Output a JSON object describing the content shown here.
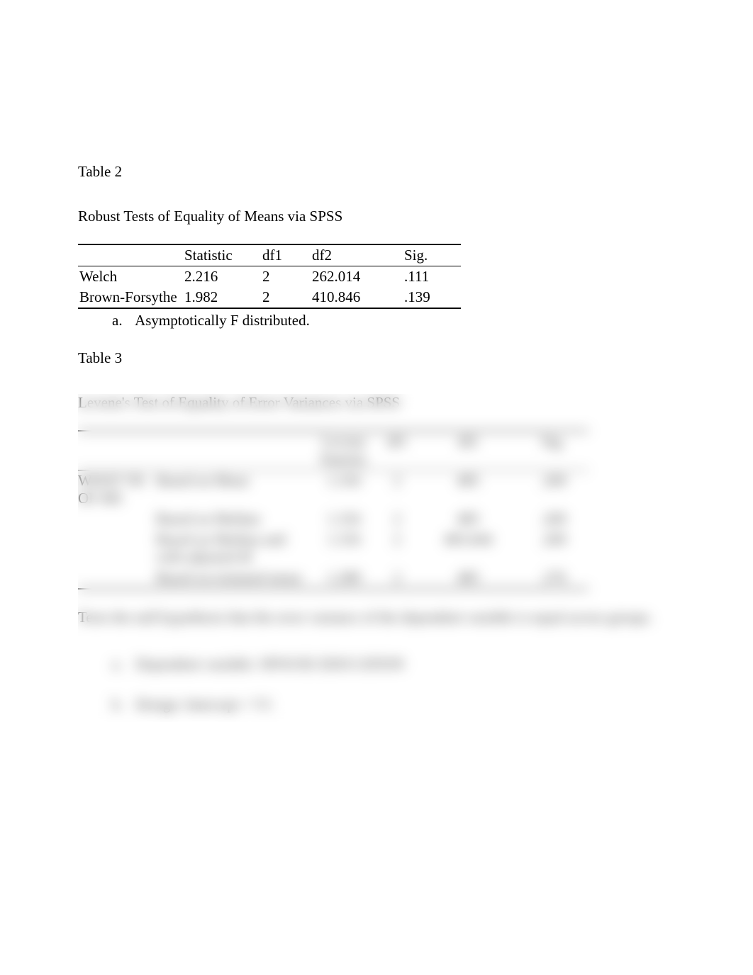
{
  "table2": {
    "label": "Table 2",
    "title": "Robust Tests of Equality of Means via SPSS",
    "headers": {
      "c0": "",
      "c1": "Statistic",
      "c2": "df1",
      "c3": "df2",
      "c4": "Sig."
    },
    "rows": [
      {
        "name": "Welch",
        "stat": "2.216",
        "df1": "2",
        "df2": "262.014",
        "sig": ".111"
      },
      {
        "name": "Brown-Forsythe",
        "stat": "1.982",
        "df1": "2",
        "df2": "410.846",
        "sig": ".139"
      }
    ],
    "note_prefix": "a.",
    "note": "Asymptotically F distributed."
  },
  "table3": {
    "label": "Table 3",
    "title": "Levene's Test of Equality of Error Variances via SPSS",
    "headers": {
      "d0": "",
      "d1": "",
      "d2": "Levene Statistic",
      "d3": "df1",
      "d4": "df2",
      "d5": "Sig."
    },
    "group_label": "WHAT YR OF MS",
    "rows": [
      {
        "basis": "Based on Mean",
        "stat": "1.316",
        "df1": "2",
        "df2": "485",
        "sig": ".269"
      },
      {
        "basis": "Based on Median",
        "stat": "1.316",
        "df1": "2",
        "df2": "485",
        "sig": ".269"
      },
      {
        "basis": "Based on Median and with adjusted df",
        "stat": "1.316",
        "df1": "2",
        "df2": "483.644",
        "sig": ".269"
      },
      {
        "basis": "Based on trimmed mean",
        "stat": "1.289",
        "df1": "2",
        "df2": "485",
        "sig": ".276"
      }
    ],
    "post_note": "Tests the null hypothesis that the error variance of the dependent variable is equal across groups.",
    "list": [
      {
        "prefix": "a.",
        "text": "Dependent variable: SPOUSE EDUCATION"
      },
      {
        "prefix": "b.",
        "text": "Design: Intercept + V1"
      }
    ]
  }
}
